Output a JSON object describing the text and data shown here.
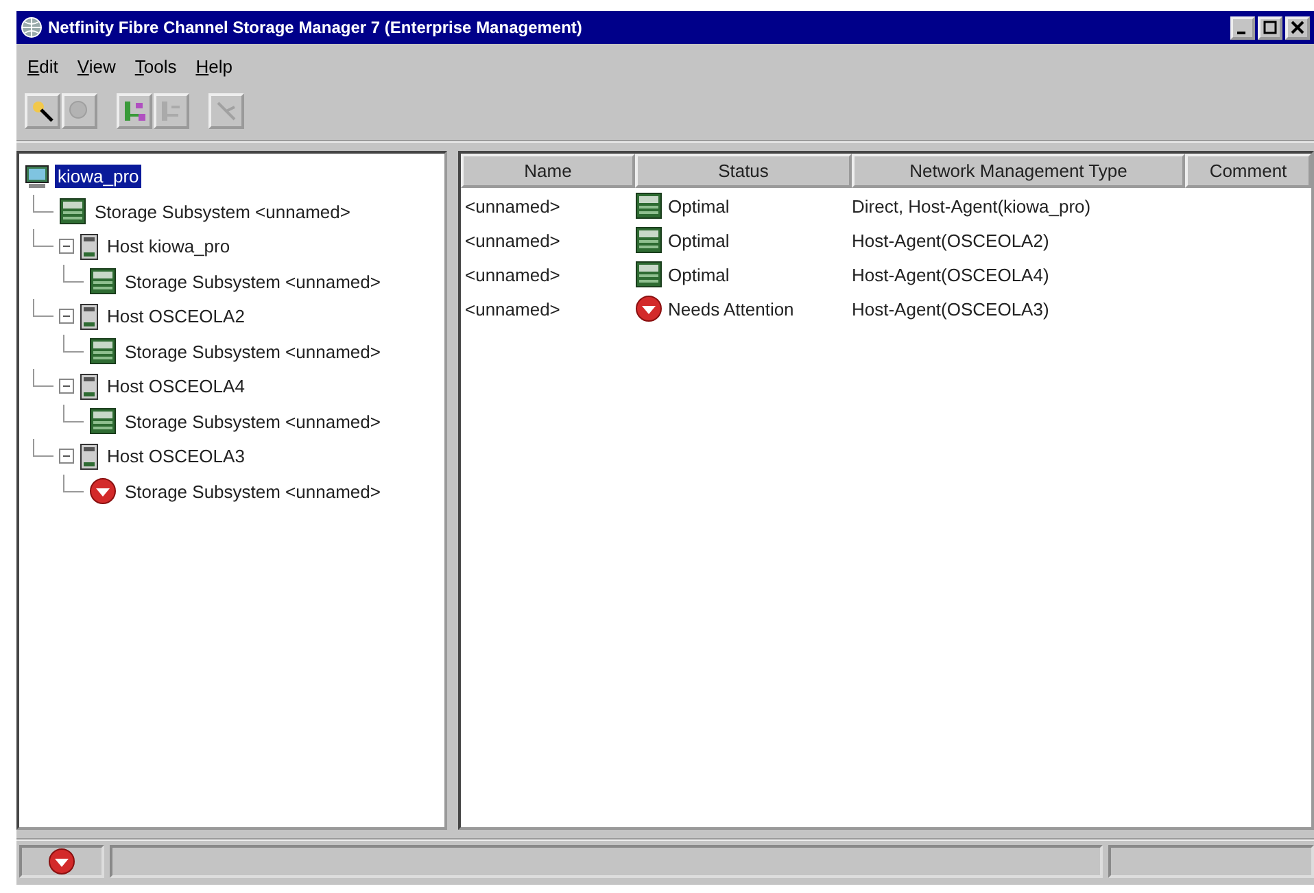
{
  "window": {
    "title": "Netfinity Fibre Channel Storage Manager 7 (Enterprise Management)"
  },
  "menu": [
    "Edit",
    "View",
    "Tools",
    "Help"
  ],
  "toolbar": [
    [
      {
        "kind": "find",
        "disabled": false
      },
      {
        "kind": "zoom",
        "disabled": true
      }
    ],
    [
      {
        "kind": "add",
        "disabled": false
      },
      {
        "kind": "remove",
        "disabled": true
      }
    ],
    [
      {
        "kind": "connect",
        "disabled": true
      }
    ]
  ],
  "tree": {
    "label": "kiowa_pro",
    "kind": "root",
    "selected": true,
    "children": [
      {
        "label": "Storage Subsystem <unnamed>",
        "kind": "subsystem",
        "needs_attention": false,
        "selected": false
      },
      {
        "label": "Host kiowa_pro",
        "kind": "host",
        "selected": false,
        "expanded": true,
        "children": [
          {
            "label": "Storage Subsystem <unnamed>",
            "kind": "subsystem",
            "needs_attention": false,
            "selected": false
          }
        ]
      },
      {
        "label": "Host OSCEOLA2",
        "kind": "host",
        "selected": false,
        "expanded": true,
        "children": [
          {
            "label": "Storage Subsystem <unnamed>",
            "kind": "subsystem",
            "needs_attention": false,
            "selected": false
          }
        ]
      },
      {
        "label": "Host OSCEOLA4",
        "kind": "host",
        "selected": false,
        "expanded": true,
        "children": [
          {
            "label": "Storage Subsystem <unnamed>",
            "kind": "subsystem",
            "needs_attention": false,
            "selected": false
          }
        ]
      },
      {
        "label": "Host OSCEOLA3",
        "kind": "host",
        "selected": false,
        "expanded": true,
        "children": [
          {
            "label": "Storage Subsystem <unnamed>",
            "kind": "subsystem",
            "needs_attention": true,
            "selected": false
          }
        ]
      }
    ]
  },
  "table": {
    "columns": [
      "Name",
      "Status",
      "Network Management Type",
      "Comment"
    ],
    "rows": [
      {
        "name": "<unnamed>",
        "status": "Optimal",
        "needs_attention": false,
        "type": "Direct, Host-Agent(kiowa_pro)"
      },
      {
        "name": "<unnamed>",
        "status": "Optimal",
        "needs_attention": false,
        "type": "Host-Agent(OSCEOLA2)"
      },
      {
        "name": "<unnamed>",
        "status": "Optimal",
        "needs_attention": false,
        "type": "Host-Agent(OSCEOLA4)"
      },
      {
        "name": "<unnamed>",
        "status": "Needs Attention",
        "needs_attention": true,
        "type": "Host-Agent(OSCEOLA3)"
      }
    ]
  },
  "status_bar": {
    "needs_attention": true
  }
}
